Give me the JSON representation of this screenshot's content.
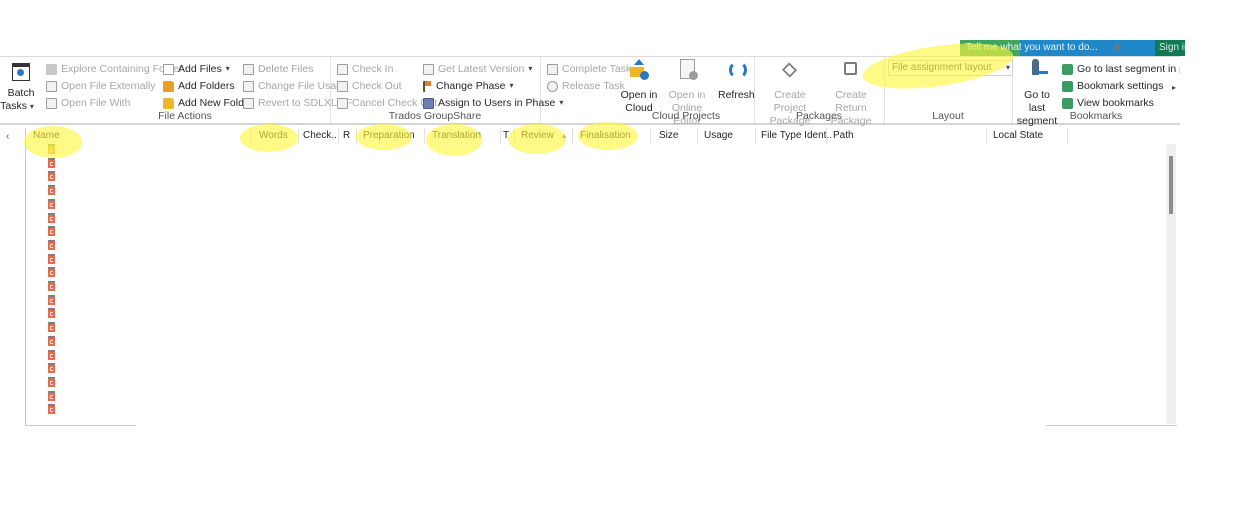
{
  "titlebar": {
    "tell_me_placeholder": "Tell me what you want to do...",
    "sign_in_label": "Sign in"
  },
  "ribbon": {
    "batch_tasks": {
      "label_line1": "Batch",
      "label_line2": "Tasks"
    },
    "file_actions": {
      "group_label": "File Actions",
      "col1": [
        {
          "label": "Explore Containing Folder",
          "enabled": false,
          "icon": "folder-icon"
        },
        {
          "label": "Open File Externally",
          "enabled": false,
          "icon": "open-file-external-icon"
        },
        {
          "label": "Open File With",
          "enabled": false,
          "icon": "open-file-with-icon"
        }
      ],
      "col2": [
        {
          "label": "Add Files",
          "enabled": true,
          "dropdown": true,
          "icon": "add-files-icon"
        },
        {
          "label": "Add Folders",
          "enabled": true,
          "icon": "add-folders-icon"
        },
        {
          "label": "Add New Folder",
          "enabled": true,
          "icon": "add-new-folder-icon"
        }
      ],
      "col3": [
        {
          "label": "Delete Files",
          "enabled": false,
          "icon": "delete-files-icon"
        },
        {
          "label": "Change File Usage",
          "enabled": false,
          "icon": "change-file-usage-icon"
        },
        {
          "label": "Revert to SDLXLIFF",
          "enabled": false,
          "icon": "revert-icon"
        }
      ]
    },
    "groupshare": {
      "group_label": "Trados GroupShare",
      "col1": [
        {
          "label": "Check In",
          "enabled": false
        },
        {
          "label": "Check Out",
          "enabled": false
        },
        {
          "label": "Cancel Check Out",
          "enabled": false
        }
      ],
      "col2": [
        {
          "label": "Get Latest Version",
          "enabled": false,
          "dropdown": true
        },
        {
          "label": "Change Phase",
          "enabled": true,
          "dropdown": true
        },
        {
          "label": "Assign to Users in Phase",
          "enabled": true,
          "dropdown": true
        }
      ],
      "col3": [
        {
          "label": "Complete Task",
          "enabled": false
        },
        {
          "label": "Release Task",
          "enabled": false
        }
      ]
    },
    "cloud_projects": {
      "group_label": "Cloud Projects",
      "open_in_cloud": {
        "line1": "Open in",
        "line2": "Cloud"
      },
      "open_online_editor": {
        "line1": "Open in",
        "line2": "Online Editor"
      },
      "refresh": "Refresh"
    },
    "packages": {
      "group_label": "Packages",
      "create_project_package": {
        "line1": "Create Project",
        "line2": "Package"
      },
      "create_return_package": {
        "line1": "Create Return",
        "line2": "Package"
      }
    },
    "layout": {
      "group_label": "Layout",
      "selected": "File assignment layout"
    },
    "bookmarks": {
      "group_label": "Bookmarks",
      "go_to_last_segment": {
        "line1": "Go to last",
        "line2": "segment"
      },
      "items": [
        {
          "label": "Go to last segment in project"
        },
        {
          "label": "Bookmark settings"
        },
        {
          "label": "View bookmarks"
        }
      ]
    }
  },
  "grid": {
    "columns": [
      {
        "key": "name",
        "label": "Name"
      },
      {
        "key": "words",
        "label": "Words"
      },
      {
        "key": "check",
        "label": "Check.."
      },
      {
        "key": "r",
        "label": "R"
      },
      {
        "key": "preparation",
        "label": "Preparation"
      },
      {
        "key": "translation",
        "label": "Translation"
      },
      {
        "key": "t",
        "label": "T"
      },
      {
        "key": "review",
        "label": "Review",
        "sorted": "ascending"
      },
      {
        "key": "finalisation",
        "label": "Finalisation"
      },
      {
        "key": "size",
        "label": "Size"
      },
      {
        "key": "usage",
        "label": "Usage"
      },
      {
        "key": "file_type",
        "label": "File Type Ident.."
      },
      {
        "key": "path",
        "label": "Path"
      },
      {
        "key": "local_state",
        "label": "Local State"
      }
    ],
    "row_count": 20,
    "collapse_arrow": "‹"
  },
  "colors": {
    "highlight": "#fff63c",
    "file_icon": "#e86a4f",
    "tell_me_bar": "#1e88c9",
    "sign_in_bar": "#0f7a55"
  }
}
